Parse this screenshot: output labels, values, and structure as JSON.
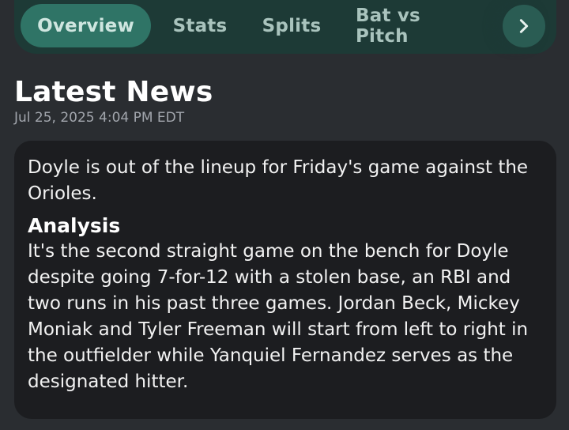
{
  "tabs": [
    {
      "label": "Overview",
      "active": true
    },
    {
      "label": "Stats",
      "active": false
    },
    {
      "label": "Splits",
      "active": false
    },
    {
      "label": "Bat vs Pitch",
      "active": false
    }
  ],
  "next_icon": "chevron-right-icon",
  "news": {
    "title": "Latest News",
    "timestamp": "Jul 25, 2025 4:04 PM EDT",
    "summary": "Doyle is out of the lineup for Friday's game against the Orioles.",
    "analysis_title": "Analysis",
    "analysis": "It's the second straight game on the bench for Doyle despite going 7-for-12 with a stolen base, an RBI and two runs in his past three games. Jordan Beck, Mickey Moniak and Tyler Freeman will start from left to right in the outfielder while Yanquiel Fernandez serves as the designated hitter."
  },
  "colors": {
    "background": "#2a2d31",
    "tabbar": "#1d3a36",
    "active_tab": "#2f7466",
    "card": "#1c1d20"
  }
}
